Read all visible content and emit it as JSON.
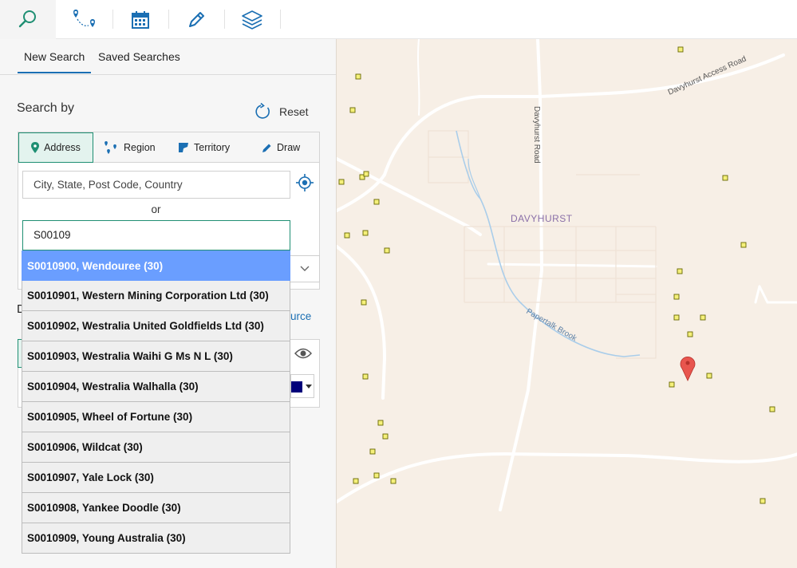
{
  "toolbar": {
    "tools": [
      {
        "icon": "search-icon",
        "active": true
      },
      {
        "icon": "route-icon",
        "active": false
      },
      {
        "icon": "calendar-icon",
        "active": false
      },
      {
        "icon": "pencil-icon",
        "active": false
      },
      {
        "icon": "layers-icon",
        "active": false
      }
    ],
    "accent_color": "#1f8f73",
    "icon_color": "#1b6fb3"
  },
  "panel": {
    "tabs": {
      "new_search": "New Search",
      "saved_searches": "Saved Searches"
    },
    "search_by_label": "Search by",
    "reset_label": "Reset",
    "modes": {
      "address": "Address",
      "region": "Region",
      "territory": "Territory",
      "draw": "Draw"
    },
    "address_placeholder": "City, State, Post Code, Country",
    "or_label": "or",
    "site_input_value": "S00109",
    "partial_label_letter": "D",
    "partial_link_text": "urce"
  },
  "suggestions": [
    "S0010900, Wendouree (30)",
    "S0010901, Western Mining Corporation Ltd (30)",
    "S0010902, Westralia United Goldfields Ltd (30)",
    "S0010903, Westralia Waihi G Ms N L (30)",
    "S0010904, Westralia Walhalla (30)",
    "S0010905, Wheel of Fortune (30)",
    "S0010906, Wildcat (30)",
    "S0010907, Yale Lock (30)",
    "S0010908, Yankee Doodle (30)",
    "S0010909, Young Australia (30)"
  ],
  "selected_suggestion_index": 0,
  "map": {
    "place_label": "DAVYHURST",
    "road_labels": {
      "davyhurst_road": "Davyhurst Road",
      "access_road": "Davyhurst Access Road",
      "brook": "Papertalk Brook"
    },
    "marker_color": "#e8554e",
    "site_square_color": "#f5f07a",
    "background_color": "#f7efe6"
  }
}
